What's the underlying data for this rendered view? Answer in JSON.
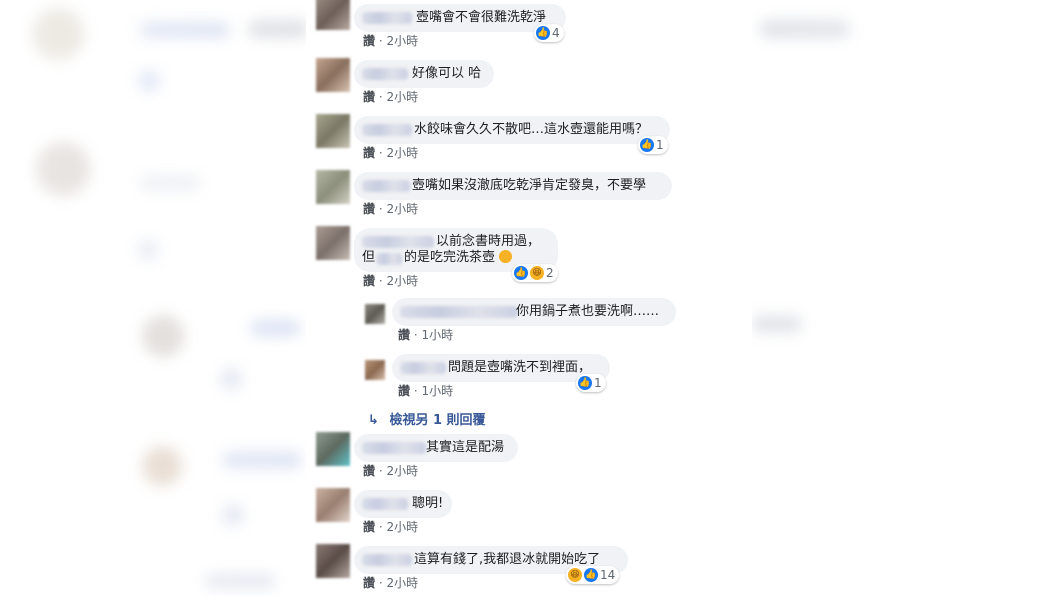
{
  "meta": {
    "like_label": "讚",
    "separator": "·"
  },
  "comments": [
    {
      "text": "壺嘴會不會很難洗乾淨",
      "time": "2小時",
      "reaction_count": "4"
    },
    {
      "text": "好像可以 哈",
      "time": "2小時",
      "reaction_count": ""
    },
    {
      "text": "水餃味會久久不散吧…這水壺還能用嗎？",
      "time": "2小時",
      "reaction_count": "1"
    },
    {
      "text": "壺嘴如果沒澈底吃乾淨肯定發臭，不要學",
      "time": "2小時",
      "reaction_count": ""
    },
    {
      "text_line1": "以前念書時用過，",
      "text_line2_a": "但",
      "text_line2_b": "的是吃完洗茶壺",
      "time": "2小時",
      "reaction_count": "2"
    },
    {
      "text": "其實這是配湯",
      "time": "2小時",
      "reaction_count": ""
    },
    {
      "text": "聰明!",
      "time": "2小時",
      "reaction_count": ""
    },
    {
      "text": "這算有錢了,我都退冰就開始吃了",
      "time": "2小時",
      "reaction_count": "14"
    }
  ],
  "replies": [
    {
      "text": "你用鍋子煮也要洗啊……",
      "time": "1小時",
      "reaction_count": ""
    },
    {
      "text": "問題是壺嘴洗不到裡面，",
      "time": "1小時",
      "reaction_count": "1"
    }
  ],
  "more_replies": {
    "arrow": "↳",
    "label": "檢視另 1 則回覆"
  },
  "colors": {
    "like_blue": "#1877f2",
    "bubble": "#f0f2f5",
    "link": "#385898",
    "meta": "#606770"
  }
}
